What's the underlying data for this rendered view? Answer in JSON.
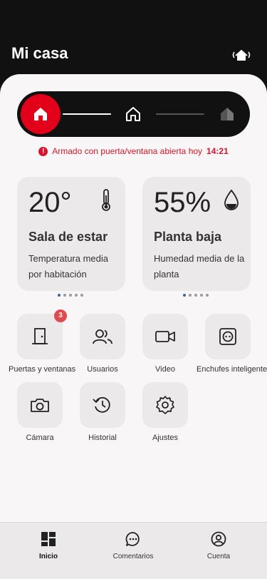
{
  "header": {
    "title": "Mi casa",
    "action_icon": "house-signal-icon"
  },
  "mode_selector": {
    "modes": [
      {
        "name": "armed-away",
        "icon": "home-icon",
        "active": true
      },
      {
        "name": "armed-home",
        "icon": "home-outline-icon",
        "active": false
      },
      {
        "name": "armed-night",
        "icon": "home-night-icon",
        "active": false
      }
    ],
    "active_color": "#e2001a"
  },
  "alert": {
    "icon": "error-circle-icon",
    "text": "Armado con puerta/ventana abierta hoy",
    "time": "14:21",
    "color": "#d6162c"
  },
  "cards": [
    {
      "value": "20°",
      "name": "Sala de estar",
      "description": "Temperatura media por habitación",
      "icon": "thermometer-icon",
      "dots": 5,
      "active_dot": 0
    },
    {
      "value": "55%",
      "name": "Planta baja",
      "description": "Humedad media de la planta",
      "icon": "humidity-drop-icon",
      "dots": 5,
      "active_dot": 0
    }
  ],
  "tiles": [
    {
      "label": "Puertas y ventanas",
      "icon": "door-icon",
      "badge": "3"
    },
    {
      "label": "Usuarios",
      "icon": "users-icon"
    },
    {
      "label": "Video",
      "icon": "video-camera-icon"
    },
    {
      "label": "Enchufes inteligentes",
      "icon": "smart-plug-icon"
    },
    {
      "label": "Cámara",
      "icon": "photo-camera-icon"
    },
    {
      "label": "Historial",
      "icon": "history-icon"
    },
    {
      "label": "Ajustes",
      "icon": "settings-gear-icon"
    }
  ],
  "tabbar": {
    "tabs": [
      {
        "label": "Inicio",
        "icon": "dashboard-icon",
        "active": true
      },
      {
        "label": "Comentarios",
        "icon": "comment-icon",
        "active": false
      },
      {
        "label": "Cuenta",
        "icon": "account-icon",
        "active": false
      }
    ]
  }
}
